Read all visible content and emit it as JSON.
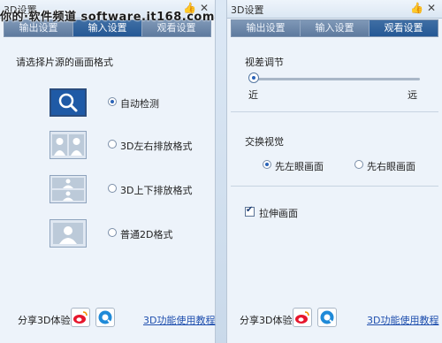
{
  "watermark": "你的·软件频道 software.it168.com",
  "left_panel": {
    "title": "3D设置",
    "tabs": [
      "输出设置",
      "输入设置",
      "观看设置"
    ],
    "active_tab": 1,
    "section_title": "请选择片源的画面格式",
    "options": [
      {
        "label": "自动检测",
        "selected": true,
        "icon": "magnifier-icon"
      },
      {
        "label": "3D左右排放格式",
        "selected": false,
        "icon": "side-by-side-icon"
      },
      {
        "label": "3D上下排放格式",
        "selected": false,
        "icon": "top-bottom-icon"
      },
      {
        "label": "普通2D格式",
        "selected": false,
        "icon": "single-person-icon"
      }
    ],
    "share_label": "分享3D体验：",
    "help_link": "3D功能使用教程"
  },
  "right_panel": {
    "title": "3D设置",
    "tabs": [
      "输出设置",
      "输入设置",
      "观看设置"
    ],
    "active_tab": 2,
    "parallax_title": "视差调节",
    "near_label": "近",
    "far_label": "远",
    "parallax_value": 0.0,
    "swap_title": "交换视觉",
    "swap_options": [
      {
        "label": "先左眼画面",
        "selected": true
      },
      {
        "label": "先右眼画面",
        "selected": false
      }
    ],
    "stretch_label": "拉伸画面",
    "stretch_checked": true,
    "share_label": "分享3D体验：",
    "help_link": "3D功能使用教程"
  },
  "colors": {
    "active_tab": "#255895",
    "inactive_tab": "#5e7a9e",
    "link": "#1f4fae",
    "weibo_red": "#e6162d",
    "qq_blue": "#1f8ad8"
  }
}
